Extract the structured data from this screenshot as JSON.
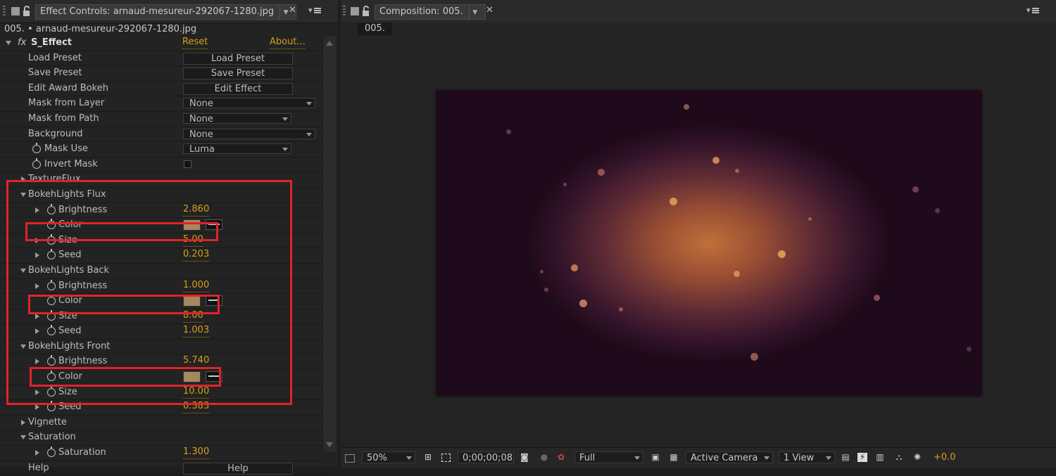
{
  "effect_controls": {
    "tab_title": "Effect Controls: arnaud-mesureur-292067-1280.jpg",
    "layer_path": "005. • arnaud-mesureur-292067-1280.jpg",
    "effect_name": "S_Effect",
    "fx_symbol": "fx",
    "reset_label": "Reset",
    "about_label": "About...",
    "rows": {
      "load_preset": {
        "label": "Load Preset",
        "button": "Load Preset"
      },
      "save_preset": {
        "label": "Save Preset",
        "button": "Save Preset"
      },
      "edit_award": {
        "label": "Edit Award Bokeh",
        "button": "Edit Effect"
      },
      "mask_from_layer": {
        "label": "Mask from Layer",
        "value": "None"
      },
      "mask_from_path": {
        "label": "Mask from Path",
        "value": "None"
      },
      "background": {
        "label": "Background",
        "value": "None"
      },
      "mask_use": {
        "label": "Mask Use",
        "value": "Luma"
      },
      "invert_mask": {
        "label": "Invert Mask",
        "checked": false
      },
      "texture_flux": {
        "label": "TextureFlux"
      },
      "flux_group": {
        "label": "BokehLights Flux"
      },
      "flux_brightness": {
        "label": "Brightness",
        "value": "2.860"
      },
      "flux_color": {
        "label": "Color",
        "swatch": "#a6875e"
      },
      "flux_size": {
        "label": "Size",
        "value": "5.00"
      },
      "flux_seed": {
        "label": "Seed",
        "value": "0.203"
      },
      "back_group": {
        "label": "BokehLights Back"
      },
      "back_brightness": {
        "label": "Brightness",
        "value": "1.000"
      },
      "back_color": {
        "label": "Color",
        "swatch": "#a6875e"
      },
      "back_size": {
        "label": "Size",
        "value": "8.00"
      },
      "back_seed": {
        "label": "Seed",
        "value": "1.003"
      },
      "front_group": {
        "label": "BokehLights Front"
      },
      "front_brightness": {
        "label": "Brightness",
        "value": "5.740"
      },
      "front_color": {
        "label": "Color",
        "swatch": "#a6875e"
      },
      "front_size": {
        "label": "Size",
        "value": "10.00"
      },
      "front_seed": {
        "label": "Seed",
        "value": "0.383"
      },
      "vignette": {
        "label": "Vignette"
      },
      "saturation_group": {
        "label": "Saturation"
      },
      "saturation": {
        "label": "Saturation",
        "value": "1.300"
      },
      "help": {
        "label": "Help",
        "button": "Help"
      }
    }
  },
  "composition": {
    "tab_title": "Composition: 005.",
    "comp_tag": "005.",
    "toolbar": {
      "zoom": "50%",
      "timecode": "0;00;00;08",
      "resolution": "Full",
      "camera": "Active Camera",
      "views": "1 View",
      "exposure": "+0.0"
    }
  },
  "colors": {
    "accent_value": "#d4a017",
    "highlight_box": "#e2222a",
    "bokeh_core": "#c0703a"
  }
}
